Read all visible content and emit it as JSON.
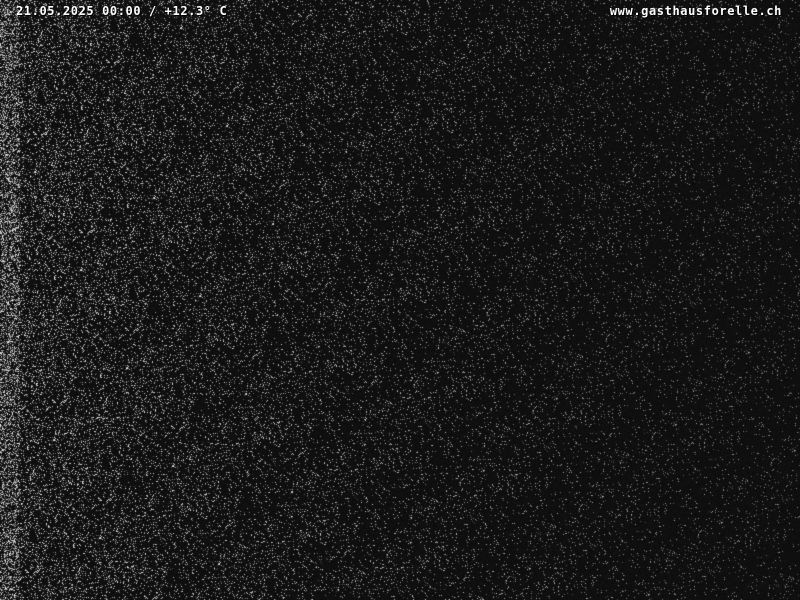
{
  "overlay": {
    "timestamp": "21.05.2025 00:00 / +12.3° C",
    "website": "www.gasthausforelle.ch"
  },
  "image": {
    "description_tag": "night-webcam-noise-frame",
    "background_color": "#0e0e0e",
    "noise_color": "#bdbdbd"
  }
}
